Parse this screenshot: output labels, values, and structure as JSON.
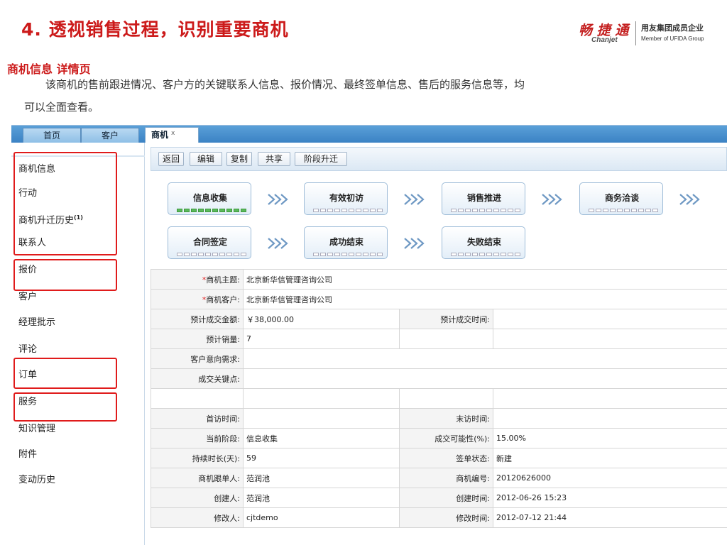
{
  "slide": {
    "title": "4. 透视销售过程，识别重要商机",
    "logo_cn": "畅 捷 通",
    "logo_en": "Chanjet",
    "logo_group_cn": "用友集团成员企业",
    "logo_group_en": "Member of UFIDA Group",
    "section_title": "商机信息 详情页",
    "desc_line1": "该商机的售前跟进情况、客户方的关键联系人信息、报价情况、最终签单信息、售后的服务信息等，均",
    "desc_line2": "可以全面查看。"
  },
  "top_tabs": [
    "首页",
    "客户"
  ],
  "module_tab": {
    "label": "商机",
    "close": "x"
  },
  "sidebar": {
    "items": [
      {
        "label": "商机信息",
        "badge": ""
      },
      {
        "label": "行动",
        "badge": ""
      },
      {
        "label": "商机升迁历史",
        "badge": "(1)"
      },
      {
        "label": "联系人",
        "badge": ""
      },
      {
        "label": "报价",
        "badge": ""
      },
      {
        "label": "客户",
        "badge": ""
      },
      {
        "label": "经理批示",
        "badge": ""
      },
      {
        "label": "评论",
        "badge": ""
      },
      {
        "label": "订单",
        "badge": ""
      },
      {
        "label": "服务",
        "badge": ""
      },
      {
        "label": "知识管理",
        "badge": ""
      },
      {
        "label": "附件",
        "badge": ""
      },
      {
        "label": "变动历史",
        "badge": ""
      }
    ]
  },
  "toolbar": {
    "back": "返回",
    "edit": "编辑",
    "copy": "复制",
    "share": "共享",
    "stage_up": "阶段升迁"
  },
  "stages": [
    {
      "label": "信息收集",
      "progress": 10
    },
    {
      "label": "有效初访",
      "progress": 0
    },
    {
      "label": "销售推进",
      "progress": 0
    },
    {
      "label": "商务洽谈",
      "progress": 0
    },
    {
      "label": "合同签定",
      "progress": 0
    },
    {
      "label": "成功结束",
      "progress": 0
    },
    {
      "label": "失败结束",
      "progress": 0
    }
  ],
  "detail": {
    "required_mark": "*",
    "subject_label": "商机主题:",
    "subject_value": "北京新华信管理咨询公司",
    "customer_label": "商机客户:",
    "customer_value": "北京新华信管理咨询公司",
    "amount_label": "预计成交金额:",
    "amount_value": "￥38,000.00",
    "close_time_label": "预计成交时间:",
    "close_time_value": "",
    "qty_label": "预计销量:",
    "qty_value": "7",
    "need_label": "客户意向需求:",
    "need_value": "",
    "key_label": "成交关键点:",
    "key_value": "",
    "first_visit_label": "首访时间:",
    "first_visit_value": "",
    "last_visit_label": "末访时间:",
    "last_visit_value": "",
    "stage_label": "当前阶段:",
    "stage_value": "信息收集",
    "prob_label": "成交可能性(%):",
    "prob_value": "15.00%",
    "duration_label": "持续时长(天):",
    "duration_value": "59",
    "sign_label": "签单状态:",
    "sign_value": "新建",
    "owner_label": "商机跟单人:",
    "owner_value": "范润池",
    "code_label": "商机编号:",
    "code_value": "20120626000",
    "creator_label": "创建人:",
    "creator_value": "范润池",
    "created_label": "创建时间:",
    "created_value": "2012-06-26 15:23",
    "modifier_label": "修改人:",
    "modifier_value": "cjtdemo",
    "modified_label": "修改时间:",
    "modified_value": "2012-07-12 21:44"
  },
  "colors": {
    "title_red": "#cc1a1a",
    "highlight_red": "#e01b1b",
    "tab_blue": "#3b82c4",
    "progress_green": "#5cb85c"
  }
}
